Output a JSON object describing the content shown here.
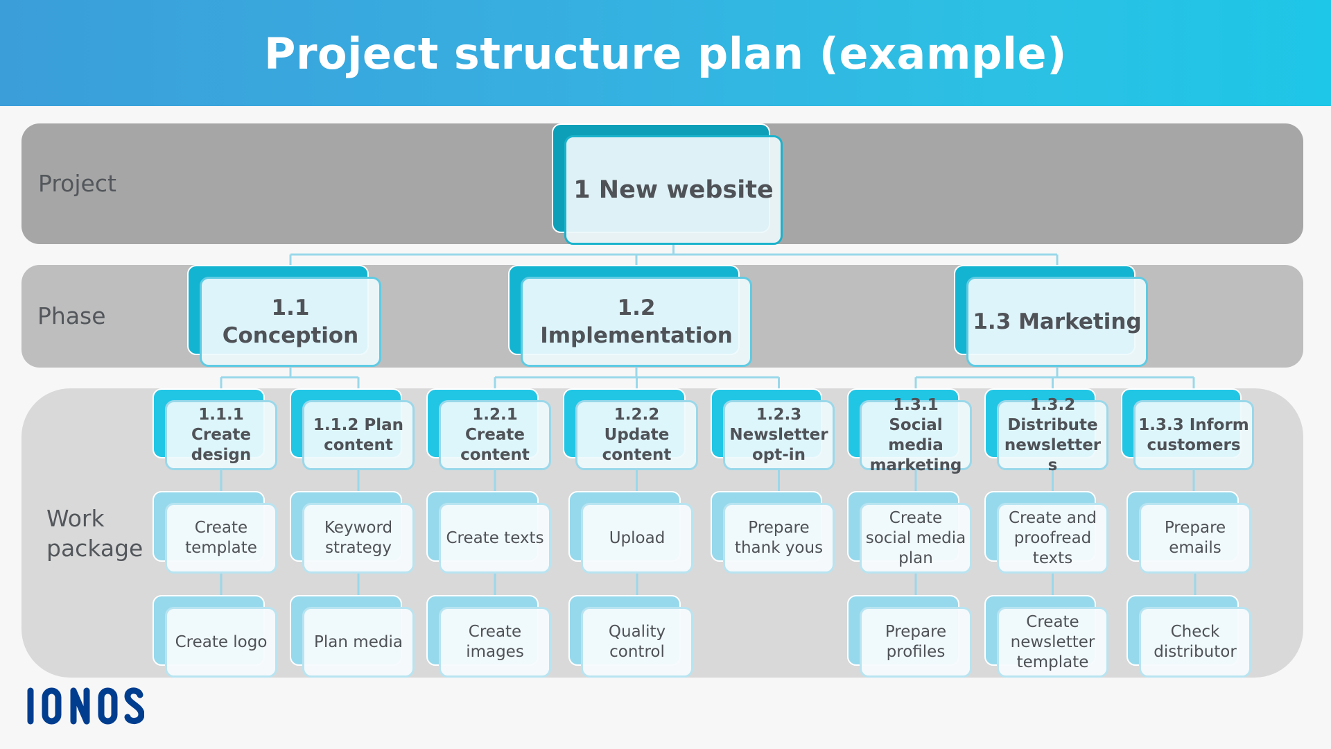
{
  "header": {
    "title": "Project structure plan (example)"
  },
  "levels": {
    "project_label": "Project",
    "phase_label": "Phase",
    "work_package_label_line1": "Work",
    "work_package_label_line2": "package"
  },
  "colors": {
    "header_gradient_start": "#3b9ed9",
    "header_gradient_end": "#1ec6e7",
    "project_band": "#a6a6a6",
    "phase_band": "#bebebe",
    "work_package_band": "#d9d9d9",
    "connector": "#9ad8ea",
    "logo": "#003d8f"
  },
  "tree": {
    "project": {
      "id": "1",
      "label": "1 New website"
    },
    "phases": [
      {
        "id": "1.1",
        "label_line1": "1.1",
        "label_line2": "Conception"
      },
      {
        "id": "1.2",
        "label_line1": "1.2",
        "label_line2": "Implementation"
      },
      {
        "id": "1.3",
        "label_line1": "1.3 Marketing",
        "label_line2": ""
      }
    ],
    "work_packages": [
      {
        "id": "1.1.1",
        "phase": "1.1",
        "lines": [
          "1.1.1 Create",
          "design"
        ],
        "tasks": [
          [
            "Create",
            "template"
          ],
          [
            "Create logo"
          ]
        ]
      },
      {
        "id": "1.1.2",
        "phase": "1.1",
        "lines": [
          "1.1.2 Plan",
          "content"
        ],
        "tasks": [
          [
            "Keyword",
            "strategy"
          ],
          [
            "Plan media"
          ]
        ]
      },
      {
        "id": "1.2.1",
        "phase": "1.2",
        "lines": [
          "1.2.1 Create",
          "content"
        ],
        "tasks": [
          [
            "Create texts"
          ],
          [
            "Create",
            "images"
          ]
        ]
      },
      {
        "id": "1.2.2",
        "phase": "1.2",
        "lines": [
          "1.2.2 Update",
          "content"
        ],
        "tasks": [
          [
            "Upload"
          ],
          [
            "Quality",
            "control"
          ]
        ]
      },
      {
        "id": "1.2.3",
        "phase": "1.2",
        "lines": [
          "1.2.3",
          "Newsletter",
          "opt-in"
        ],
        "tasks": [
          [
            "Prepare",
            "thank yous"
          ]
        ]
      },
      {
        "id": "1.3.1",
        "phase": "1.3",
        "lines": [
          "1.3.1 Social",
          "media",
          "marketing"
        ],
        "tasks": [
          [
            "Create",
            "social media",
            "plan"
          ],
          [
            "Prepare",
            "profiles"
          ]
        ]
      },
      {
        "id": "1.3.2",
        "phase": "1.3",
        "lines": [
          "1.3.2",
          "Distribute",
          "newsletter",
          "s"
        ],
        "tasks": [
          [
            "Create and",
            "proofread",
            "texts"
          ],
          [
            "Create",
            "newsletter",
            "template"
          ]
        ]
      },
      {
        "id": "1.3.3",
        "phase": "1.3",
        "lines": [
          "1.3.3 Inform",
          "customers"
        ],
        "tasks": [
          [
            "Prepare",
            "emails"
          ],
          [
            "Check",
            "distributor"
          ]
        ]
      }
    ]
  },
  "footer": {
    "logo_text": "IONOS"
  }
}
